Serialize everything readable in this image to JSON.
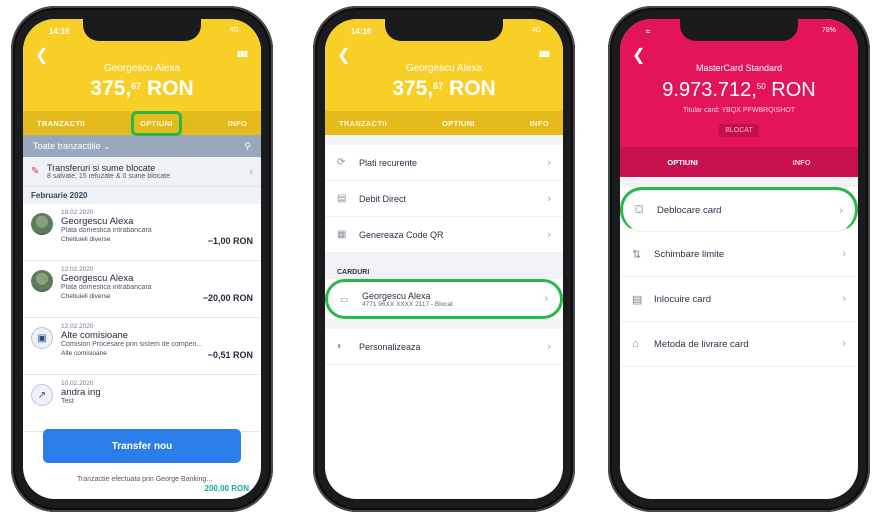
{
  "phone1": {
    "status_time": "14:16",
    "status_signal": "4G",
    "account_name": "Georgescu Alexa",
    "balance_int": "375,",
    "balance_dec": "67",
    "balance_cur": "RON",
    "tabs": [
      "TRANZACTII",
      "OPTIUNI",
      "INFO"
    ],
    "filter_label": "Toate tranzactiile",
    "blocked_title": "Transferuri si sume blocate",
    "blocked_sub": "8 salvate, 15 refuzate & 0 sume blocate",
    "month": "Februarie 2020",
    "transactions": [
      {
        "date": "18.02.2020",
        "name": "Georgescu Alexa",
        "sub": "Plata domestica intrabancara",
        "category": "Cheltuieli diverse",
        "amount": "−1,00 RON"
      },
      {
        "date": "12.02.2020",
        "name": "Georgescu Alexa",
        "sub": "Plata domestica intrabancara",
        "category": "Cheltuieli diverse",
        "amount": "−20,00 RON"
      },
      {
        "date": "12.02.2020",
        "name": "Alte comisioane",
        "sub": "Comision Procesare prin sistem de compen...",
        "category": "Alte comisioane",
        "amount": "−0,51 RON"
      },
      {
        "date": "10.02.2020",
        "name": "andra ing",
        "sub": "Test",
        "category": "",
        "amount": ""
      }
    ],
    "transfer_button": "Transfer nou",
    "peek_text": "Tranzactie efectuata prin George Banking...",
    "peek_amount": "200,00 RON"
  },
  "phone2": {
    "status_time": "14:16",
    "status_signal": "4G",
    "account_name": "Georgescu Alexa",
    "balance_int": "375,",
    "balance_dec": "67",
    "balance_cur": "RON",
    "tabs": [
      "TRANZACTII",
      "OPTIUNI",
      "INFO"
    ],
    "options": [
      "Plati recurente",
      "Debit Direct",
      "Genereaza Code QR"
    ],
    "cards_label": "CARDURI",
    "card_name": "Georgescu Alexa",
    "card_sub": "4771 96XX XXXX 2117 - Blocat",
    "personalize": "Personalizeaza"
  },
  "phone3": {
    "status_signal": "78%",
    "card_title": "MasterCard Standard",
    "balance_int": "9.973.712,",
    "balance_dec": "50",
    "balance_cur": "RON",
    "holder": "Titular card: YBQX PFWBRQISHOT",
    "badge": "BLOCAT",
    "tabs": [
      "OPTIUNI",
      "INFO"
    ],
    "options": [
      "Deblocare card",
      "Schimbare limite",
      "Inlocuire card",
      "Metoda de livrare card"
    ]
  },
  "colors": {
    "yellow": "#f7cf27",
    "pink": "#e4145b",
    "green_highlight": "#27b84a",
    "blue_button": "#2b7de9"
  }
}
